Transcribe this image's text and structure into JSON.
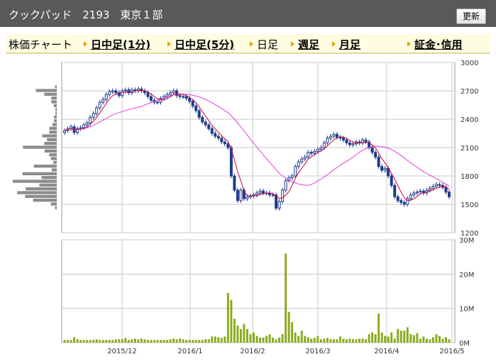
{
  "header": {
    "title": "クックパッド　2193　東京１部",
    "update_label": "更新"
  },
  "tabs": [
    {
      "label": "株価チャート",
      "link": false,
      "arrow": false
    },
    {
      "label": "日中足(1分)",
      "link": true,
      "arrow": true
    },
    {
      "label": "日中足(5分)",
      "link": true,
      "arrow": true
    },
    {
      "label": "日足",
      "link": false,
      "arrow": true
    },
    {
      "label": "週足",
      "link": true,
      "arrow": true
    },
    {
      "label": "月足",
      "link": true,
      "arrow": true
    },
    {
      "label": "証金･信用",
      "link": true,
      "arrow": true
    }
  ],
  "colors": {
    "up": "#ffffff",
    "down": "#1f3c8c",
    "ma_short": "#d0003a",
    "ma_long": "#e040e0",
    "volume": "#8caa1e",
    "profile": "#8c8c8c",
    "grid": "#c8c8c8"
  },
  "chart_data": [
    {
      "type": "candlestick",
      "title": "",
      "x_labels": [
        "2015/12",
        "2016/1",
        "2016/2",
        "2016/3",
        "2016/4",
        "2016/5"
      ],
      "y_ticks": [
        "3000",
        "2700",
        "2400",
        "2100",
        "1800",
        "1500",
        "1200"
      ],
      "ylim": [
        1200,
        3000
      ],
      "close": [
        2280,
        2300,
        2320,
        2260,
        2300,
        2310,
        2340,
        2360,
        2420,
        2460,
        2520,
        2580,
        2610,
        2660,
        2690,
        2700,
        2680,
        2650,
        2700,
        2710,
        2680,
        2710,
        2700,
        2720,
        2700,
        2680,
        2640,
        2600,
        2580,
        2580,
        2620,
        2640,
        2660,
        2680,
        2700,
        2650,
        2640,
        2640,
        2620,
        2590,
        2540,
        2490,
        2420,
        2370,
        2340,
        2300,
        2250,
        2220,
        2200,
        2160,
        2140,
        2100,
        1800,
        1650,
        1540,
        1650,
        1560,
        1580,
        1590,
        1600,
        1620,
        1640,
        1620,
        1620,
        1600,
        1600,
        1460,
        1530,
        1650,
        1750,
        1780,
        1800,
        1900,
        1950,
        1980,
        2000,
        2050,
        2040,
        2060,
        2080,
        2100,
        2150,
        2200,
        2220,
        2240,
        2210,
        2200,
        2180,
        2150,
        2130,
        2140,
        2160,
        2150,
        2180,
        2160,
        2100,
        2050,
        2000,
        1900,
        1860,
        1880,
        1800,
        1700,
        1580,
        1540,
        1520,
        1500,
        1560,
        1600,
        1620,
        1630,
        1640,
        1620,
        1650,
        1670,
        1690,
        1710,
        1700,
        1680,
        1630,
        1580
      ],
      "volume_ticks": [
        "30M",
        "20M",
        "10M",
        "0M"
      ],
      "volume_max": 30,
      "volume": [
        0.8,
        0.8,
        0.8,
        1.6,
        1.0,
        0.8,
        0.8,
        0.8,
        0.8,
        0.8,
        1.0,
        0.8,
        0.8,
        0.8,
        0.8,
        0.8,
        1.0,
        1.0,
        1.0,
        1.4,
        0.8,
        1.0,
        1.2,
        1.0,
        1.2,
        1.0,
        0.8,
        0.8,
        0.8,
        0.8,
        0.8,
        0.8,
        0.8,
        1.0,
        1.2,
        1.0,
        1.2,
        1.0,
        0.8,
        0.8,
        0.8,
        0.8,
        0.8,
        0.8,
        1.0,
        1.0,
        1.8,
        1.8,
        1.6,
        1.4,
        1.8,
        14.5,
        12.5,
        7.0,
        5.0,
        4.0,
        5.5,
        4.0,
        2.5,
        3.0,
        2.0,
        1.5,
        1.5,
        2.0,
        2.5,
        1.5,
        1.0,
        1.5,
        2.5,
        26.0,
        9.0,
        6.0,
        3.0,
        2.0,
        3.5,
        2.0,
        1.6,
        1.2,
        1.4,
        2.0,
        1.0,
        1.2,
        1.4,
        1.0,
        1.0,
        1.0,
        1.8,
        1.2,
        1.0,
        1.2,
        1.0,
        1.0,
        1.2,
        1.2,
        1.0,
        2.5,
        3.0,
        2.5,
        8.5,
        3.0,
        2.0,
        1.8,
        3.0,
        1.2,
        4.0,
        3.5,
        3.5,
        4.5,
        2.5,
        2.2,
        2.8,
        1.2,
        1.8,
        1.2,
        1.0,
        1.6,
        2.5,
        2.0,
        1.2,
        1.6,
        1.0
      ]
    }
  ]
}
